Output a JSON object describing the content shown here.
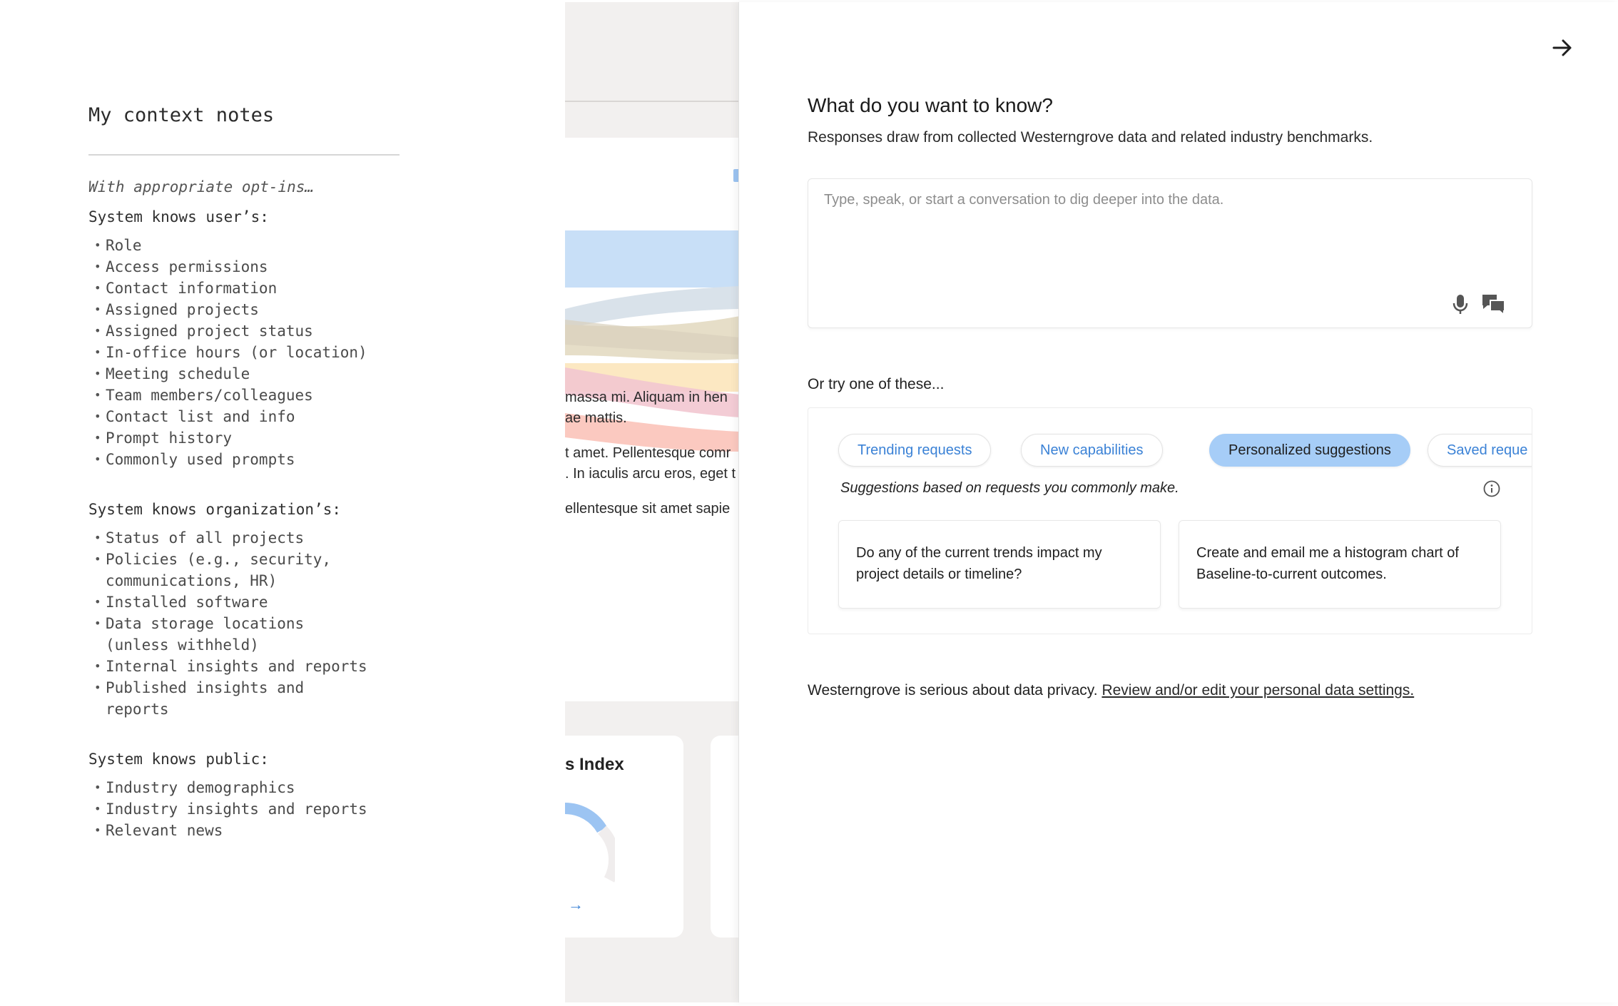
{
  "notes": {
    "title": "My context notes",
    "intro": "With appropriate opt-ins…",
    "sections": [
      {
        "heading": "System knows user’s:",
        "items": [
          "Role",
          "Access permissions",
          "Contact information",
          "Assigned projects",
          "Assigned project status",
          "In-office hours (or location)",
          "Meeting schedule",
          "Team members/colleagues",
          "Contact list and info",
          "Prompt history",
          "Commonly used prompts"
        ]
      },
      {
        "heading": "System knows organization’s:",
        "items": [
          "Status of all projects",
          "Policies (e.g., security, communications, HR)",
          "Installed software",
          "Data storage locations (unless withheld)",
          "Internal insights and reports",
          "Published insights and reports"
        ]
      },
      {
        "heading": "System knows public:",
        "items": [
          "Industry demographics",
          "Industry insights and reports",
          "Relevant news"
        ]
      }
    ]
  },
  "background": {
    "text_lines": [
      "massa mi. Aliquam in hen",
      "ae mattis.",
      "t amet. Pellentesque comr",
      ". In iaculis arcu eros, eget t",
      "ellentesque sit amet sapie"
    ],
    "index_label": "s Index",
    "arrow": "→"
  },
  "panel": {
    "title": "What do you want to know?",
    "subtitle": "Responses draw from collected Westerngrove data and related industry benchmarks.",
    "query_placeholder": "Type, speak, or start a conversation to dig deeper into the data.",
    "try_label": "Or try one of these...",
    "tabs": [
      {
        "label": "Trending requests",
        "active": false
      },
      {
        "label": "New capabilities",
        "active": false
      },
      {
        "label": "Personalized suggestions",
        "active": true
      },
      {
        "label": "Saved reque",
        "active": false
      }
    ],
    "suggestions_caption": "Suggestions based on requests you commonly make.",
    "suggestions": [
      "Do any of the current trends impact my project details or timeline?",
      "Create and email me a histogram chart of Baseline-to-current outcomes."
    ],
    "privacy_text": "Westerngrove is serious about data privacy. ",
    "privacy_link": "Review and/or edit your personal data settings.",
    "icons": {
      "close": "arrow-right-icon",
      "mic": "microphone-icon",
      "chat": "chat-bubbles-icon",
      "info": "info-icon"
    },
    "colors": {
      "accent": "#3b82d6",
      "active_tab": "#a6cdf7"
    }
  }
}
